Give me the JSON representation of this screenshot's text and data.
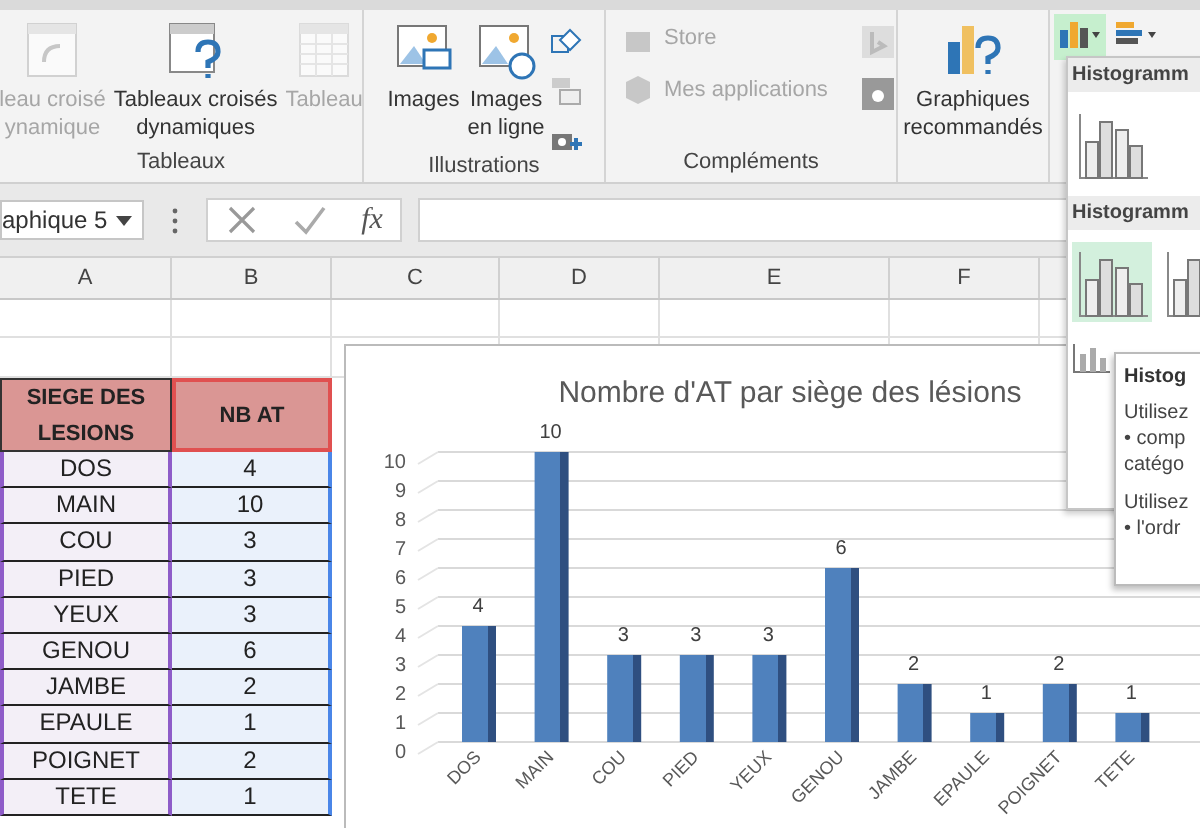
{
  "ribbon": {
    "groups": [
      {
        "label": "Tableaux",
        "buttons": [
          {
            "lines": [
              "leau croisé",
              "ynamique"
            ],
            "disabled": true
          },
          {
            "lines": [
              "Tableaux croisés",
              "dynamiques"
            ],
            "disabled": false
          },
          {
            "lines": [
              "Tableau"
            ],
            "disabled": true
          }
        ]
      },
      {
        "label": "Illustrations",
        "buttons": [
          {
            "lines": [
              "Images"
            ],
            "disabled": false
          },
          {
            "lines": [
              "Images",
              "en ligne"
            ],
            "disabled": false
          }
        ]
      },
      {
        "label": "Compléments",
        "buttons": [
          {
            "lines": [
              "Store"
            ],
            "disabled": true
          },
          {
            "lines": [
              "Mes applications"
            ],
            "disabled": true
          }
        ]
      },
      {
        "buttons": [
          {
            "lines": [
              "Graphiques",
              "recommandés"
            ],
            "disabled": false
          }
        ]
      }
    ],
    "chart_buttons": [
      {
        "selected": true
      },
      {
        "selected": false
      }
    ]
  },
  "formula_bar": {
    "name_box": "aphique 5",
    "fx": "fx"
  },
  "columns": [
    "A",
    "B",
    "C",
    "D",
    "E",
    "F"
  ],
  "table": {
    "headers": [
      "SIEGE DES LESIONS",
      "NB AT"
    ],
    "rows": [
      [
        "DOS",
        "4"
      ],
      [
        "MAIN",
        "10"
      ],
      [
        "COU",
        "3"
      ],
      [
        "PIED",
        "3"
      ],
      [
        "YEUX",
        "3"
      ],
      [
        "GENOU",
        "6"
      ],
      [
        "JAMBE",
        "2"
      ],
      [
        "EPAULE",
        "1"
      ],
      [
        "POIGNET",
        "2"
      ],
      [
        "TETE",
        "1"
      ]
    ]
  },
  "chart": {
    "chart_data": {
      "type": "bar",
      "title": "Nombre d'AT par siège des lésions",
      "categories": [
        "DOS",
        "MAIN",
        "COU",
        "PIED",
        "YEUX",
        "GENOU",
        "JAMBE",
        "EPAULE",
        "POIGNET",
        "TETE"
      ],
      "values": [
        4,
        10,
        3,
        3,
        3,
        6,
        2,
        1,
        2,
        1
      ],
      "ylim": [
        0,
        10
      ],
      "yticks": [
        0,
        1,
        2,
        3,
        4,
        5,
        6,
        7,
        8,
        9,
        10
      ],
      "data_labels": true,
      "grid": true
    }
  },
  "dropdown": {
    "sections": [
      {
        "title": "Histogramm",
        "items": [
          {
            "selected": false
          }
        ]
      },
      {
        "title": "Histogramm",
        "items": [
          {
            "selected": true
          },
          {
            "selected": false
          }
        ]
      }
    ]
  },
  "tooltip": {
    "title": "Histog",
    "paragraphs": [
      [
        "Utilisez",
        "• comp",
        "catégo"
      ],
      [
        "Utilisez",
        "• l'ordr"
      ]
    ]
  }
}
